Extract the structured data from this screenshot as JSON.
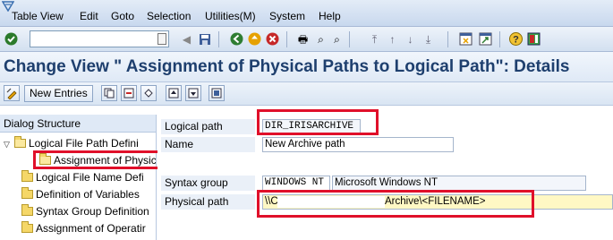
{
  "menu": {
    "items": [
      "Table View",
      "Edit",
      "Goto",
      "Selection",
      "Utilities(M)",
      "System",
      "Help"
    ]
  },
  "standard_toolbar": {
    "command_field_value": ""
  },
  "title": "Change View \" Assignment of Physical Paths to Logical Path\": Details",
  "app_toolbar": {
    "new_entries_label": "New Entries"
  },
  "dialog_structure": {
    "header": "Dialog Structure",
    "items": [
      "Logical File Path Defini",
      "Assignment of Physical Paths to Logical Path",
      "Logical File Name Defi",
      "Definition of Variables",
      "Syntax Group Definition",
      "Assignment of Operatir"
    ]
  },
  "details": {
    "logical_path_label": "Logical path",
    "logical_path_value": "DIR_IRISARCHIVE",
    "name_label": "Name",
    "name_value": "New Archive path",
    "syntax_group_label": "Syntax group",
    "syntax_group_value": "WINDOWS NT",
    "syntax_group_desc": "Microsoft Windows NT",
    "physical_path_label": "Physical path",
    "physical_path_prefix": "\\\\C:\\",
    "physical_path_suffix": "Archive\\<FILENAME>"
  },
  "colors": {
    "highlight": "#e0102a",
    "title": "#1e3f6e"
  }
}
